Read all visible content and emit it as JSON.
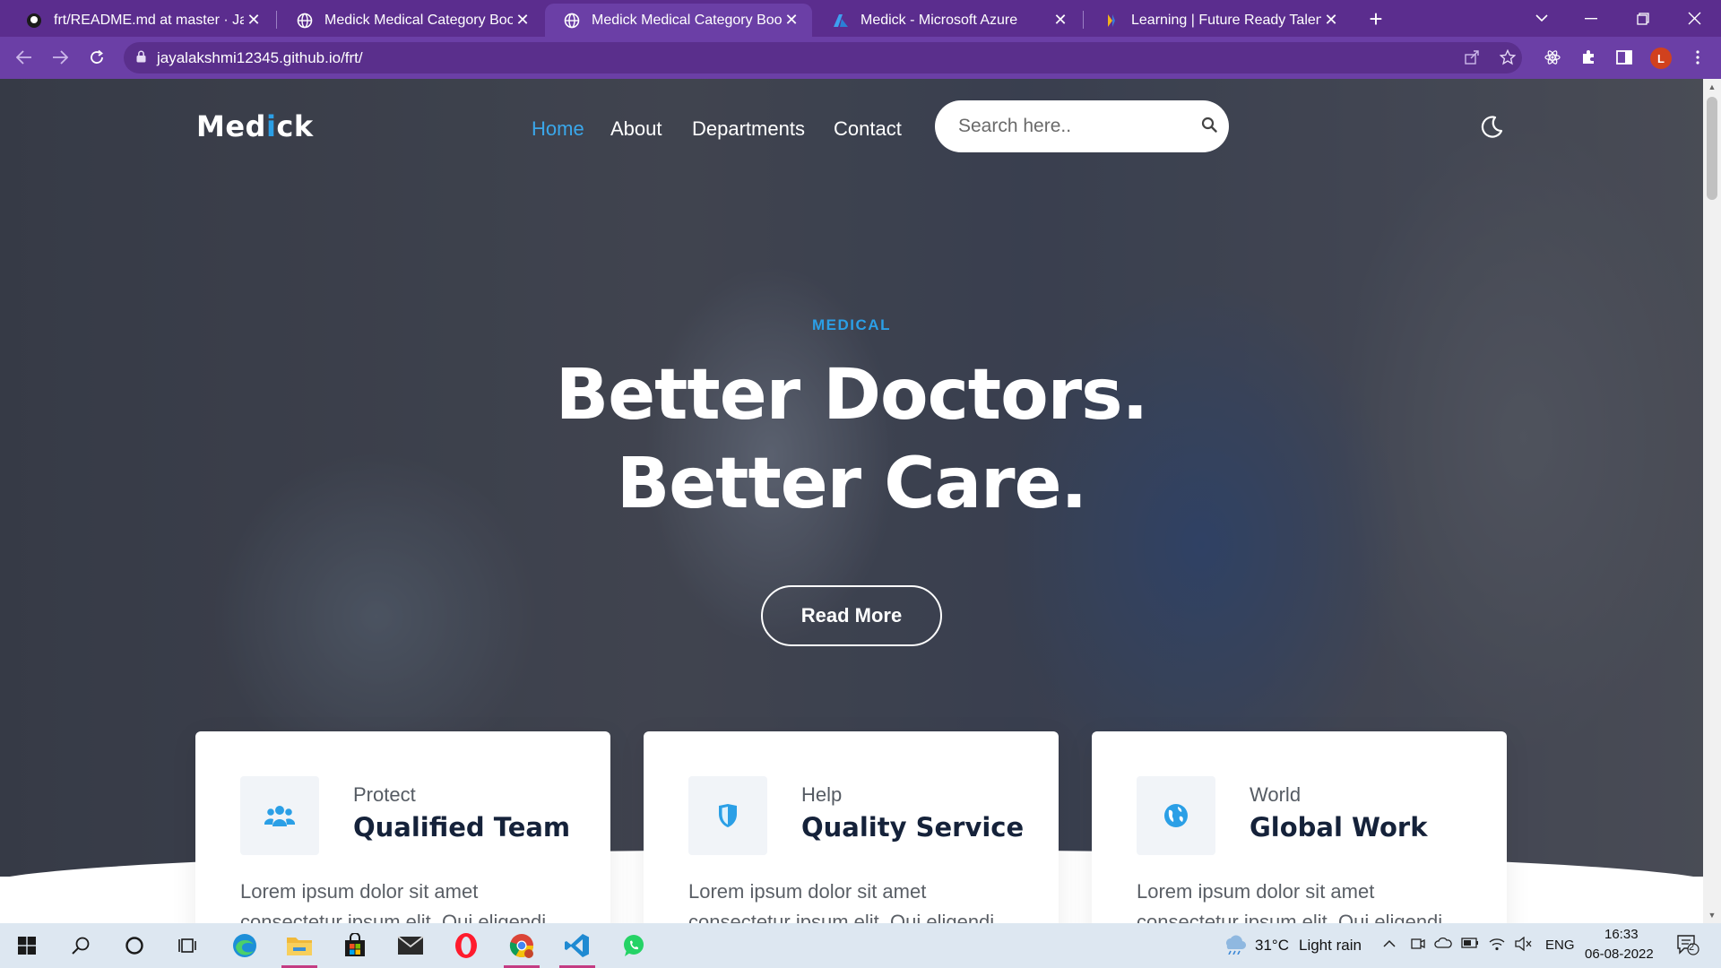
{
  "browser": {
    "tabs": [
      {
        "title": "frt/README.md at master · Jayala",
        "icon": "github-icon",
        "active": false
      },
      {
        "title": "Medick Medical Category Bootstr",
        "icon": "globe-icon",
        "active": false
      },
      {
        "title": "Medick Medical Category Bootstr",
        "icon": "globe-icon",
        "active": true
      },
      {
        "title": "Medick - Microsoft Azure",
        "icon": "azure-icon",
        "active": false
      },
      {
        "title": "Learning | Future Ready Talent",
        "icon": "microsoft-learn-icon",
        "active": false
      }
    ],
    "url": "jayalakshmi12345.github.io/frt/",
    "profile_initial": "L"
  },
  "site": {
    "logo": {
      "part1": "Med",
      "accent": "i",
      "part2": "ck"
    },
    "nav": [
      {
        "label": "Home",
        "active": true
      },
      {
        "label": "About",
        "active": false
      },
      {
        "label": "Departments",
        "active": false
      },
      {
        "label": "Contact",
        "active": false
      }
    ],
    "search": {
      "placeholder": "Search here.."
    },
    "hero": {
      "eyebrow": "MEDICAL",
      "line1": "Better Doctors.",
      "line2": "Better Care.",
      "button": "Read More"
    },
    "cards": [
      {
        "subtitle": "Protect",
        "title": "Qualified Team",
        "text": "Lorem ipsum dolor sit amet consectetur ipsum elit. Qui eligendi",
        "icon": "users-icon"
      },
      {
        "subtitle": "Help",
        "title": "Quality Service",
        "text": "Lorem ipsum dolor sit amet consectetur ipsum elit. Qui eligendi",
        "icon": "shield-icon"
      },
      {
        "subtitle": "World",
        "title": "Global Work",
        "text": "Lorem ipsum dolor sit amet consectetur ipsum elit. Qui eligendi",
        "icon": "globe-icon"
      }
    ]
  },
  "taskbar": {
    "weather": {
      "temp": "31°C",
      "desc": "Light rain"
    },
    "lang": "ENG",
    "time": "16:33",
    "date": "06-08-2022",
    "notifications": "2"
  },
  "colors": {
    "chrome_tabstrip": "#5b2d8e",
    "chrome_toolbar": "#6b3fa6",
    "accent_blue": "#2b9fe6",
    "heading_dark": "#15223a"
  }
}
